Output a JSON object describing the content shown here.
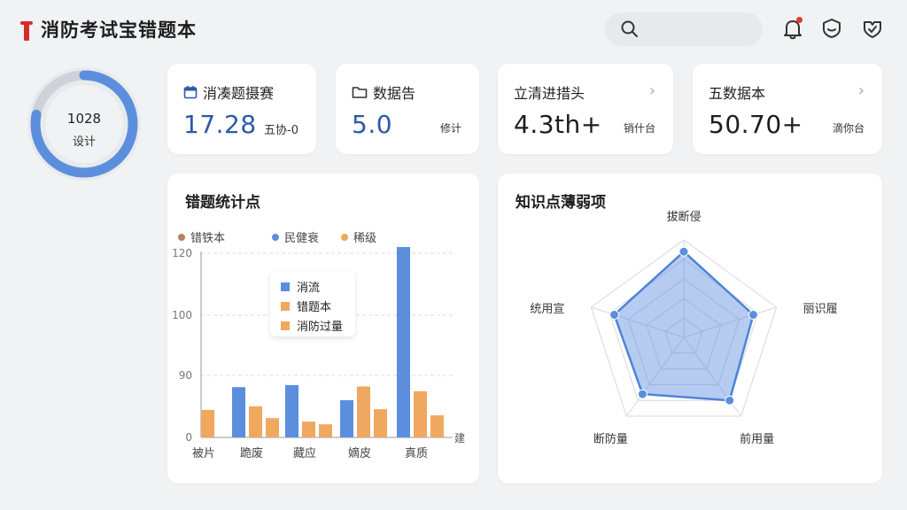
{
  "header": {
    "title": "消防考试宝错题本",
    "search_placeholder": ""
  },
  "ring": {
    "value": "1028",
    "label": "设计",
    "progress": 0.78
  },
  "stats": [
    {
      "label": "消凑题摄赛",
      "value": "17.28",
      "unit": "五协-0",
      "icon": "calendar-icon"
    },
    {
      "label": "数据告",
      "value": "5.0",
      "unit": "修计",
      "icon": "folder-icon"
    },
    {
      "label": "立清进措头",
      "value": "4.3th+",
      "unit": "销什台",
      "icon": "chevron-right-icon"
    },
    {
      "label": "五数据本",
      "value": "50.70+",
      "unit": "滴你台",
      "icon": "chevron-right-icon"
    }
  ],
  "bar_panel": {
    "title": "错题统计点",
    "legend": [
      "错铁本",
      "民健衰",
      "稀级"
    ],
    "tooltip": [
      "消流",
      "错题本",
      "消防过量"
    ],
    "axis_end_label": "建"
  },
  "radar_panel": {
    "title": "知识点薄弱项"
  },
  "colors": {
    "blue": "#5b8fde",
    "orange": "#f0a860",
    "brown": "#b8806a",
    "accent_blue": "#2d59a8",
    "notif_red": "#e23a2f"
  },
  "chart_data": [
    {
      "type": "bar",
      "title": "错题统计点",
      "categories": [
        "被片",
        "跪废",
        "藏应",
        "嫡皮",
        "真质"
      ],
      "series": [
        {
          "name": "消流",
          "values": [
            0,
            73,
            76,
            54,
            122
          ]
        },
        {
          "name": "错题本",
          "values": [
            40,
            45,
            23,
            74,
            67
          ]
        },
        {
          "name": "消防过量",
          "values": [
            0,
            28,
            19,
            41,
            32
          ]
        }
      ],
      "y_ticks": [
        "0",
        "90",
        "100",
        "120"
      ],
      "legend_position": "top-left",
      "grid": true
    },
    {
      "type": "radar",
      "title": "知识点薄弱项",
      "axes": [
        "拔断侵",
        "丽识履",
        "前用量",
        "断防量",
        "统用宣"
      ],
      "values": [
        0.88,
        0.75,
        0.8,
        0.72,
        0.75
      ],
      "legend_position": "none"
    }
  ]
}
